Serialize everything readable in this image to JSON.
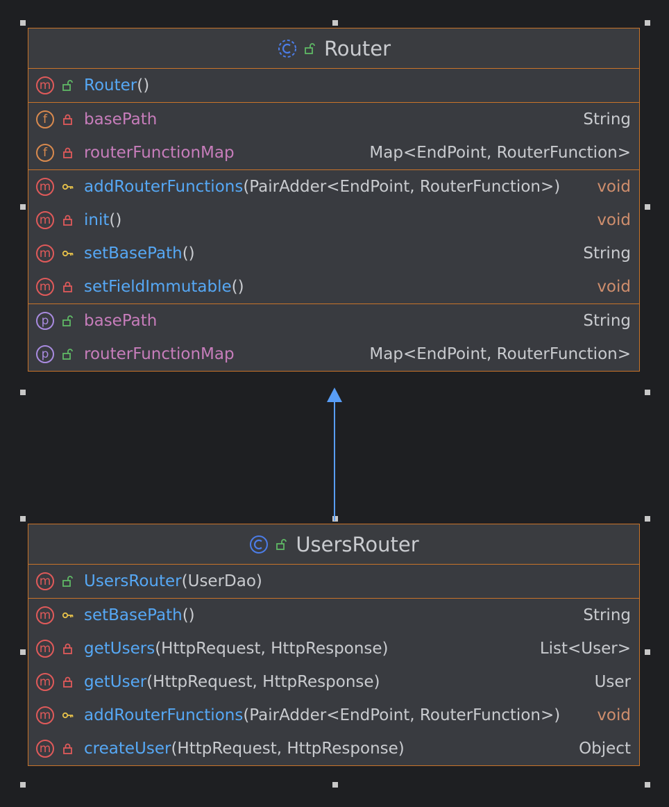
{
  "colors": {
    "background": "#1e1f22",
    "class_border": "#c9742a",
    "class_fill": "#393b40",
    "method_name": "#56a8f5",
    "field_name": "#c77dbb",
    "void_type": "#cf8e6d",
    "arrow": "#589df6"
  },
  "classes": [
    {
      "name": "Router",
      "kind_icon": "class-abstract-icon",
      "visibility_icon": "public-lock-icon",
      "sections": [
        {
          "members": [
            {
              "kind": "m",
              "visibility": "public",
              "name": "Router",
              "params": "()",
              "type": "",
              "type_void": false
            }
          ]
        },
        {
          "members": [
            {
              "kind": "f",
              "visibility": "private",
              "name": "basePath",
              "params": "",
              "type": "String",
              "type_void": false
            },
            {
              "kind": "f",
              "visibility": "private",
              "name": "routerFunctionMap",
              "params": "",
              "type": "Map<EndPoint, RouterFunction>",
              "type_void": false
            }
          ]
        },
        {
          "members": [
            {
              "kind": "m",
              "visibility": "protected",
              "name": "addRouterFunctions",
              "params": "(PairAdder<EndPoint, RouterFunction>)",
              "type": "void",
              "type_void": true
            },
            {
              "kind": "m",
              "visibility": "private",
              "name": "init",
              "params": "()",
              "type": "void",
              "type_void": true
            },
            {
              "kind": "m",
              "visibility": "protected",
              "name": "setBasePath",
              "params": "()",
              "type": "String",
              "type_void": false
            },
            {
              "kind": "m",
              "visibility": "private",
              "name": "setFieldImmutable",
              "params": "()",
              "type": "void",
              "type_void": true
            }
          ]
        },
        {
          "members": [
            {
              "kind": "p",
              "visibility": "public",
              "name": "basePath",
              "params": "",
              "type": "String",
              "type_void": false
            },
            {
              "kind": "p",
              "visibility": "public",
              "name": "routerFunctionMap",
              "params": "",
              "type": "Map<EndPoint, RouterFunction>",
              "type_void": false
            }
          ]
        }
      ]
    },
    {
      "name": "UsersRouter",
      "kind_icon": "class-icon",
      "visibility_icon": "public-lock-icon",
      "sections": [
        {
          "members": [
            {
              "kind": "m",
              "visibility": "public",
              "name": "UsersRouter",
              "params": "(UserDao)",
              "type": "",
              "type_void": false
            }
          ]
        },
        {
          "members": [
            {
              "kind": "m",
              "visibility": "protected",
              "name": "setBasePath",
              "params": "()",
              "type": "String",
              "type_void": false
            },
            {
              "kind": "m",
              "visibility": "private",
              "name": "getUsers",
              "params": "(HttpRequest, HttpResponse)",
              "type": "List<User>",
              "type_void": false
            },
            {
              "kind": "m",
              "visibility": "private",
              "name": "getUser",
              "params": "(HttpRequest, HttpResponse)",
              "type": "User",
              "type_void": false
            },
            {
              "kind": "m",
              "visibility": "protected",
              "name": "addRouterFunctions",
              "params": "(PairAdder<EndPoint, RouterFunction>)",
              "type": "void",
              "type_void": true
            },
            {
              "kind": "m",
              "visibility": "private",
              "name": "createUser",
              "params": "(HttpRequest, HttpResponse)",
              "type": "Object",
              "type_void": false
            }
          ]
        }
      ]
    }
  ],
  "edges": [
    {
      "from": "UsersRouter",
      "to": "Router",
      "type": "generalization"
    }
  ]
}
